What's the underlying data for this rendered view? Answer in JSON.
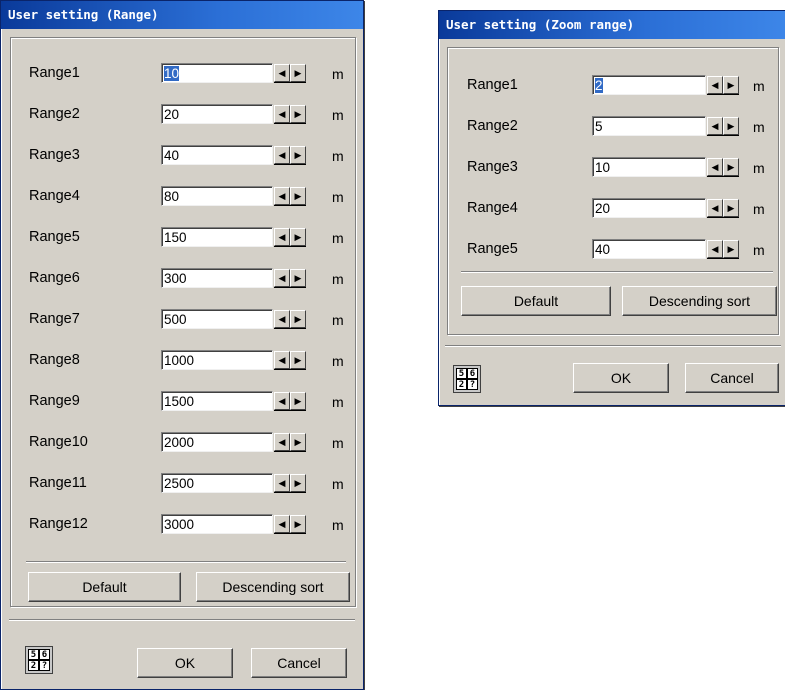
{
  "dialog_range": {
    "title": "User setting (Range)",
    "unit": "m",
    "rows": [
      {
        "label": "Range1",
        "value": "10"
      },
      {
        "label": "Range2",
        "value": "20"
      },
      {
        "label": "Range3",
        "value": "40"
      },
      {
        "label": "Range4",
        "value": "80"
      },
      {
        "label": "Range5",
        "value": "150"
      },
      {
        "label": "Range6",
        "value": "300"
      },
      {
        "label": "Range7",
        "value": "500"
      },
      {
        "label": "Range8",
        "value": "1000"
      },
      {
        "label": "Range9",
        "value": "1500"
      },
      {
        "label": "Range10",
        "value": "2000"
      },
      {
        "label": "Range11",
        "value": "2500"
      },
      {
        "label": "Range12",
        "value": "3000"
      }
    ],
    "default_label": "Default",
    "sort_label": "Descending sort",
    "ok_label": "OK",
    "cancel_label": "Cancel"
  },
  "dialog_zoom": {
    "title": "User setting (Zoom range)",
    "unit": "m",
    "rows": [
      {
        "label": "Range1",
        "value": "2"
      },
      {
        "label": "Range2",
        "value": "5"
      },
      {
        "label": "Range3",
        "value": "10"
      },
      {
        "label": "Range4",
        "value": "20"
      },
      {
        "label": "Range5",
        "value": "40"
      }
    ],
    "default_label": "Default",
    "sort_label": "Descending sort",
    "ok_label": "OK",
    "cancel_label": "Cancel"
  },
  "icon": {
    "name": "keypad-icon",
    "digits": [
      "5",
      "6",
      "2",
      "?"
    ]
  },
  "colors": {
    "titlebar": "#0a3a9a",
    "dialog_bg": "#d4d0c8",
    "selection": "#316ac5"
  }
}
